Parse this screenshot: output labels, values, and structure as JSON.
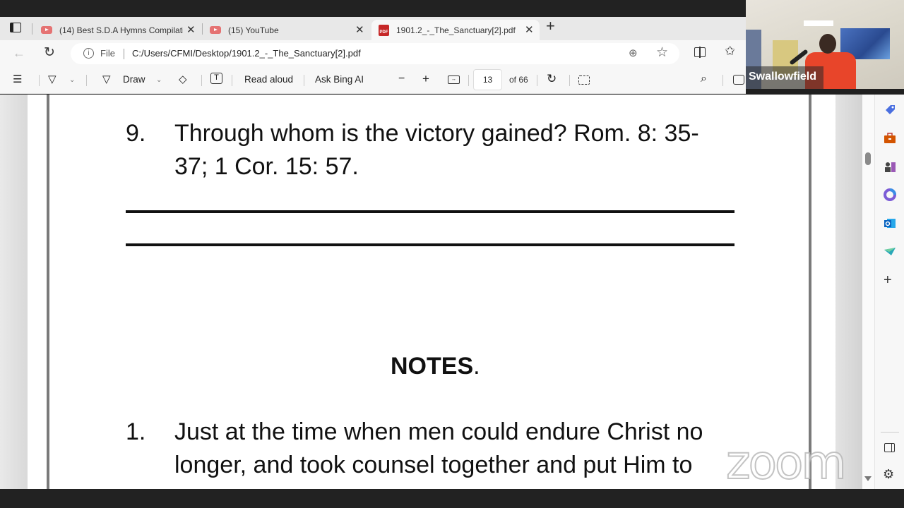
{
  "browser": {
    "tabs": [
      {
        "title": "(14) Best S.D.A Hymns Compilati",
        "icon": "youtube-icon",
        "active": false
      },
      {
        "title": "(15) YouTube",
        "icon": "youtube-icon",
        "active": false
      },
      {
        "title": "1901.2_-_The_Sanctuary[2].pdf",
        "icon": "pdf-icon",
        "active": true
      }
    ],
    "close_glyph": "✕",
    "new_tab_glyph": "+",
    "address": {
      "scheme_label": "File",
      "url": "C:/Users/CFMI/Desktop/1901.2_-_The_Sanctuary[2].pdf"
    }
  },
  "pdf_toolbar": {
    "draw_label": "Draw",
    "read_aloud_label": "Read aloud",
    "ask_ai_label": "Ask Bing AI",
    "current_page": "13",
    "page_total_label": "of 66"
  },
  "document": {
    "question": {
      "number": "9.",
      "line1": "Through whom is the victory gained? Rom. 8: 35-",
      "line2": "37; 1 Cor. 15: 57."
    },
    "notes_heading": "NOTES",
    "notes_period": ".",
    "note1": {
      "number": "1.",
      "line1": "Just at the time when men could endure Christ no",
      "line2": "longer, and took counsel together and put Him to"
    }
  },
  "video": {
    "participant_name": "Swallowfield"
  },
  "watermark": "zoom"
}
